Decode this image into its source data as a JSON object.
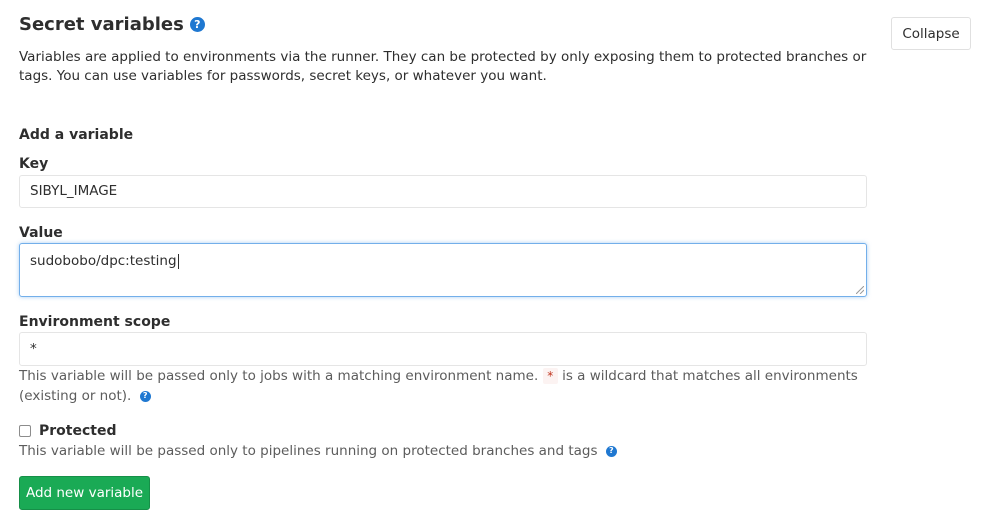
{
  "section": {
    "title": "Secret variables",
    "description": "Variables are applied to environments via the runner. They can be protected by only exposing them to protected branches or tags. You can use variables for passwords, secret keys, or whatever you want.",
    "collapse_label": "Collapse"
  },
  "form": {
    "heading": "Add a variable",
    "key": {
      "label": "Key",
      "value": "SIBYL_IMAGE"
    },
    "value": {
      "label": "Value",
      "value": "sudobobo/dpc:testing"
    },
    "scope": {
      "label": "Environment scope",
      "value": "*",
      "hint_before": "This variable will be passed only to jobs with a matching environment name.",
      "hint_code": "*",
      "hint_after": "is a wildcard that matches all environments (existing or not)."
    },
    "protected": {
      "label": "Protected",
      "checked": false,
      "hint": "This variable will be passed only to pipelines running on protected branches and tags"
    },
    "submit_label": "Add new variable"
  },
  "icons": {
    "help": "question-circle-icon"
  },
  "colors": {
    "accent": "#1f78d1",
    "submit": "#1aaa55",
    "focus": "#73afea"
  }
}
